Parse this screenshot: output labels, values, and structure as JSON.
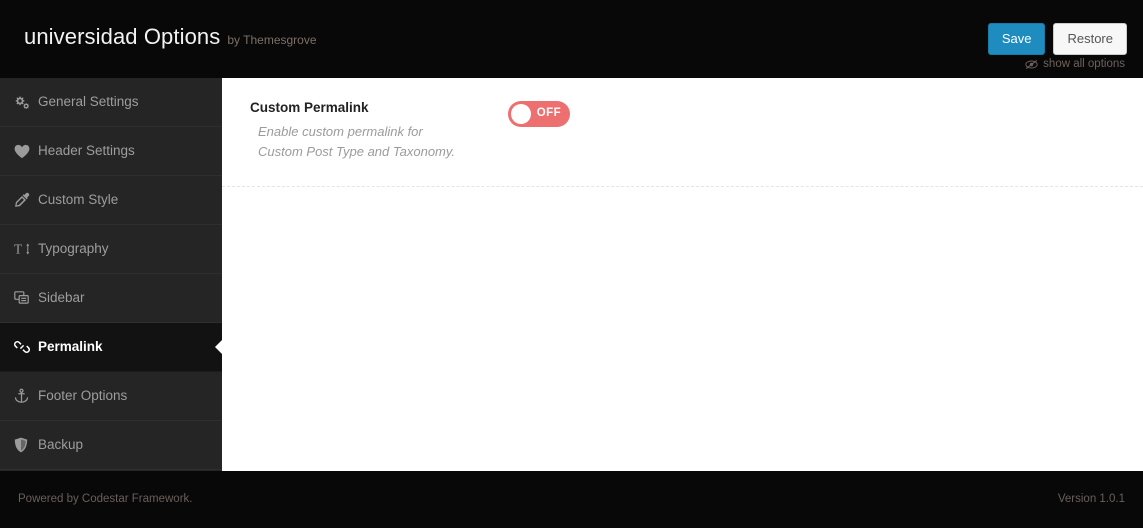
{
  "header": {
    "title": "universidad Options",
    "subtitle": "by Themesgrove",
    "save_label": "Save",
    "restore_label": "Restore",
    "show_all_label": "show all options",
    "show_all_icon": "eye-slash-icon",
    "save_color": "#1e8cbe",
    "restore_color": "#f7f7f7"
  },
  "sidebar": {
    "items": [
      {
        "label": "General Settings",
        "icon": "gears-icon",
        "active": false
      },
      {
        "label": "Header Settings",
        "icon": "heart-icon",
        "active": false
      },
      {
        "label": "Custom Style",
        "icon": "eyedropper-icon",
        "active": false
      },
      {
        "label": "Typography",
        "icon": "text-height-icon",
        "active": false
      },
      {
        "label": "Sidebar",
        "icon": "clone-icon",
        "active": false
      },
      {
        "label": "Permalink",
        "icon": "link-chain-icon",
        "active": true
      },
      {
        "label": "Footer Options",
        "icon": "anchor-icon",
        "active": false
      },
      {
        "label": "Backup",
        "icon": "shield-icon",
        "active": false
      }
    ],
    "active_index": 5,
    "background": "#252525",
    "active_background": "#121212"
  },
  "main": {
    "fields": [
      {
        "title": "Custom Permalink",
        "description": "Enable custom permalink for Custom Post Type and Taxonomy.",
        "control": {
          "type": "toggle",
          "state": "OFF",
          "checked": false,
          "color": "#ee6f6f"
        }
      }
    ]
  },
  "footer": {
    "powered_by": "Powered by Codestar Framework.",
    "version": "Version 1.0.1"
  }
}
